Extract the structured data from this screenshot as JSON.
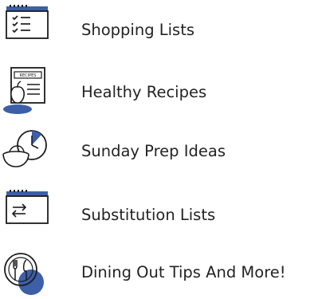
{
  "colors": {
    "accent_blue": "#3c5fa8",
    "ink": "#1c1c1c",
    "text": "#232323"
  },
  "items": [
    {
      "label": "Shopping Lists",
      "icon": "checklist-calendar-icon"
    },
    {
      "label": "Healthy Recipes",
      "icon": "recipe-card-apple-icon"
    },
    {
      "label": "Sunday Prep Ideas",
      "icon": "clock-meal-bowl-icon"
    },
    {
      "label": "Substitution Lists",
      "icon": "swap-arrows-calendar-icon"
    },
    {
      "label": "Dining Out Tips And More!",
      "icon": "fork-knife-plate-icon"
    }
  ]
}
